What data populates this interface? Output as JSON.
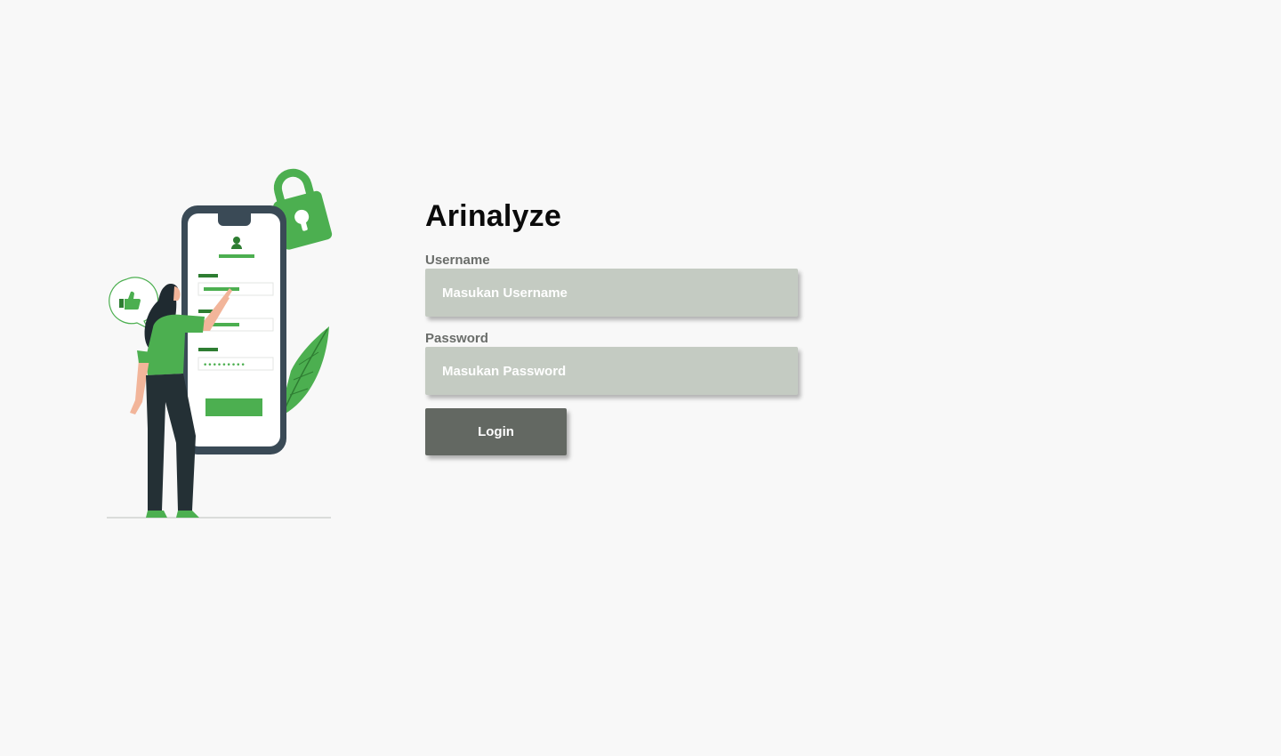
{
  "app": {
    "title": "Arinalyze"
  },
  "form": {
    "username_label": "Username",
    "username_placeholder": "Masukan Username",
    "username_value": "",
    "password_label": "Password",
    "password_placeholder": "Masukan Password",
    "password_value": "",
    "login_label": "Login"
  },
  "illustration": {
    "description_icon": "login-illustration",
    "masked_password": "•••••••••"
  },
  "colors": {
    "background": "#f8f8f8",
    "input_bg": "#c4cbc2",
    "button_bg": "#636862",
    "accent_green": "#4caf50",
    "dark_slate": "#3a4a56"
  }
}
